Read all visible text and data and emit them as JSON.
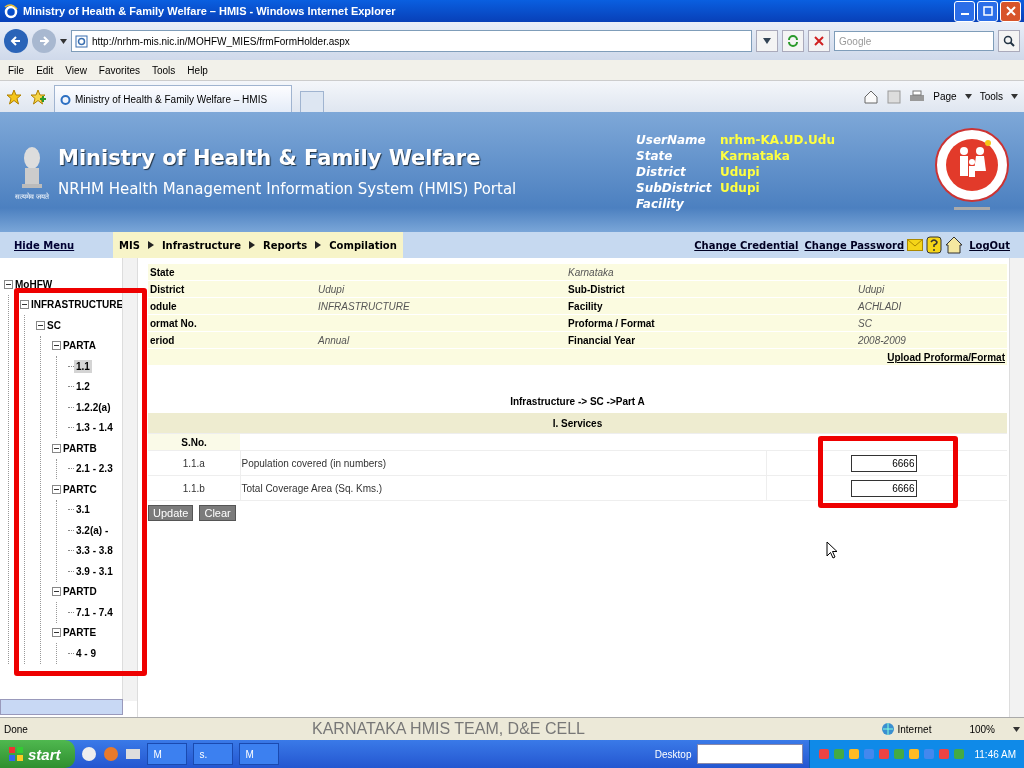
{
  "window": {
    "title": "Ministry of Health & Family Welfare – HMIS - Windows Internet Explorer"
  },
  "address": {
    "url": "http://nrhm-mis.nic.in/MOHFW_MIES/frmFormHolder.aspx",
    "search_placeholder": "Google"
  },
  "menu": [
    "File",
    "Edit",
    "View",
    "Favorites",
    "Tools",
    "Help"
  ],
  "browser_tab": {
    "title": "Ministry of Health & Family Welfare – HMIS"
  },
  "command_bar": [
    "Page",
    "Tools"
  ],
  "header": {
    "title": "Ministry of Health & Family Welfare",
    "subtitle": "NRHM Health Management Information System (HMIS) Portal",
    "emblem_caption": "सत्यमेव जयते",
    "user_info": [
      {
        "label": "UserName",
        "value": "nrhm-KA.UD.Udu"
      },
      {
        "label": "State",
        "value": "Karnataka"
      },
      {
        "label": "District",
        "value": "Udupi"
      },
      {
        "label": "SubDistrict",
        "value": "Udupi"
      },
      {
        "label": "Facility"
      }
    ]
  },
  "nav": {
    "hide_menu": "Hide Menu",
    "breadcrumbs": [
      "MIS",
      "Infrastructure",
      "Reports",
      "Compilation"
    ],
    "links": [
      "Change Credential",
      "Change Password"
    ],
    "logout": "LogOut"
  },
  "tree": [
    {
      "label": "MoHFW",
      "selected": false,
      "expanded": true,
      "children": [
        {
          "label": "INFRASTRUCTURE",
          "selected": false,
          "expanded": true,
          "children": [
            {
              "label": "SC",
              "selected": false,
              "expanded": true,
              "children": [
                {
                  "label": "PARTA",
                  "selected": false,
                  "expanded": true,
                  "children": [
                    {
                      "label": "1.1",
                      "selected": true
                    },
                    {
                      "label": "1.2",
                      "selected": false
                    },
                    {
                      "label": "1.2.2(a)",
                      "selected": false
                    },
                    {
                      "label": "1.3 - 1.4",
                      "selected": false
                    }
                  ]
                },
                {
                  "label": "PARTB",
                  "selected": false,
                  "expanded": true,
                  "children": [
                    {
                      "label": "2.1 - 2.3",
                      "selected": false
                    }
                  ]
                },
                {
                  "label": "PARTC",
                  "selected": false,
                  "expanded": true,
                  "children": [
                    {
                      "label": "3.1",
                      "selected": false
                    },
                    {
                      "label": "3.2(a) -",
                      "selected": false
                    },
                    {
                      "label": "3.3 - 3.8",
                      "selected": false
                    },
                    {
                      "label": "3.9 - 3.1",
                      "selected": false
                    }
                  ]
                },
                {
                  "label": "PARTD",
                  "selected": false,
                  "expanded": true,
                  "children": [
                    {
                      "label": "7.1 - 7.4",
                      "selected": false
                    }
                  ]
                },
                {
                  "label": "PARTE",
                  "selected": false,
                  "expanded": true,
                  "children": [
                    {
                      "label": "4 - 9",
                      "selected": false
                    }
                  ]
                }
              ]
            }
          ]
        }
      ]
    }
  ],
  "info_rows": [
    [
      "State",
      "",
      "Karnataka",
      ""
    ],
    [
      "District",
      "Udupi",
      "Sub-District",
      "Udupi"
    ],
    [
      "odule",
      "INFRASTRUCTURE",
      "Facility",
      "ACHLADI"
    ],
    [
      "ormat No.",
      "",
      "Proforma / Format",
      "SC"
    ],
    [
      "eriod",
      "Annual",
      "Financial Year",
      "2008-2009"
    ]
  ],
  "upload_link": "Upload Proforma/Format",
  "path": "Infrastructure -> SC ->Part A",
  "services": {
    "title": "I. Services",
    "sno_header": "S.No.",
    "rows": [
      {
        "sno": "1.1.a",
        "label": "Population covered (in numbers)",
        "value": "6666"
      },
      {
        "sno": "1.1.b",
        "label": "Total Coverage Area (Sq. Kms.)",
        "value": "6666"
      }
    ]
  },
  "buttons": [
    "Update",
    "Clear"
  ],
  "status": {
    "text": "Done",
    "footer": "KARNATAKA HMIS TEAM, D&E CELL",
    "zone": "Internet",
    "zoom": "100%"
  },
  "taskbar": {
    "start": "start",
    "tasks": [
      "M",
      "s.",
      "M"
    ],
    "desktop": "Desktop",
    "time": "11:46 AM"
  }
}
